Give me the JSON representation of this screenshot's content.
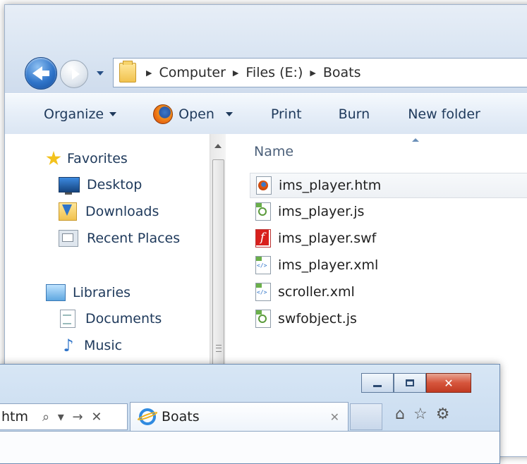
{
  "explorer": {
    "breadcrumb": [
      "Computer",
      "Files (E:)",
      "Boats"
    ],
    "toolbar": {
      "organize": "Organize",
      "open": "Open",
      "print": "Print",
      "burn": "Burn",
      "new_folder": "New folder"
    },
    "nav": {
      "favorites": "Favorites",
      "desktop": "Desktop",
      "downloads": "Downloads",
      "recent_places": "Recent Places",
      "libraries": "Libraries",
      "documents": "Documents",
      "music": "Music"
    },
    "column_name": "Name",
    "files": [
      {
        "name": "ims_player.htm",
        "icon": "firefox-html-icon"
      },
      {
        "name": "ims_player.js",
        "icon": "script-file-icon"
      },
      {
        "name": "ims_player.swf",
        "icon": "flash-file-icon"
      },
      {
        "name": "ims_player.xml",
        "icon": "xml-file-icon"
      },
      {
        "name": "scroller.xml",
        "icon": "xml-file-icon"
      },
      {
        "name": "swfobject.js",
        "icon": "script-file-icon"
      }
    ]
  },
  "ie": {
    "address_text": "htm",
    "address_controls": "⌕ ▾ → ✕",
    "tab_title": "Boats",
    "tab_close": "✕",
    "close_glyph": "✕",
    "tools": [
      "⌂",
      "☆",
      "⚙"
    ]
  },
  "colors": {
    "accent": "#2f74c9",
    "close_red": "#c13a22",
    "chrome_blue": "#dbe6f3"
  }
}
